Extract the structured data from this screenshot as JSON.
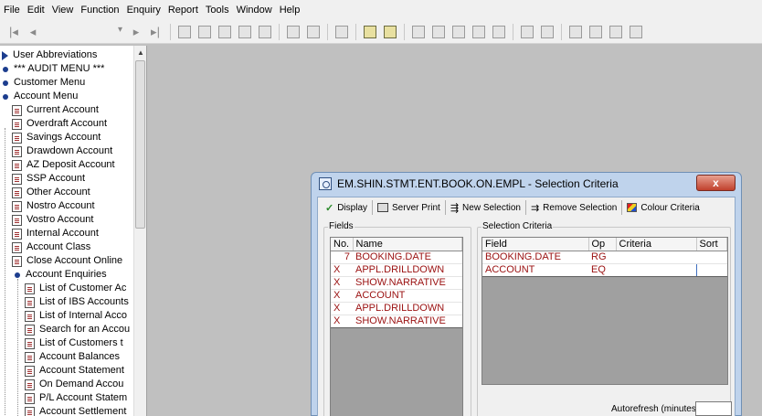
{
  "menubar": {
    "items": [
      {
        "u": "F",
        "rest": "ile"
      },
      {
        "u": "E",
        "rest": "dit"
      },
      {
        "u": "V",
        "rest": "iew"
      },
      {
        "u": "F",
        "rest": "unction",
        "pre": ""
      },
      {
        "u": "",
        "rest": "Enquiry",
        "pre": "",
        "mid_u": "q"
      },
      {
        "u": "R",
        "rest": "eport"
      },
      {
        "u": "T",
        "rest": "ools"
      },
      {
        "u": "W",
        "rest": "indow"
      },
      {
        "u": "H",
        "rest": "elp"
      }
    ],
    "labels": [
      "File",
      "Edit",
      "View",
      "Function",
      "Enquiry",
      "Report",
      "Tools",
      "Window",
      "Help"
    ]
  },
  "tree": {
    "items": [
      {
        "label": "User Abbreviations",
        "icon": "arrow-icon"
      },
      {
        "label": "*** AUDIT MENU ***",
        "icon": "dot-icon"
      },
      {
        "label": "Customer Menu",
        "icon": "dot-icon"
      },
      {
        "label": "Account Menu",
        "icon": "dot-icon"
      },
      {
        "label": "Current Account",
        "icon": "doc-icon"
      },
      {
        "label": "Overdraft Account",
        "icon": "doc-icon"
      },
      {
        "label": "Savings Account",
        "icon": "doc-icon"
      },
      {
        "label": "Drawdown Account",
        "icon": "doc-icon"
      },
      {
        "label": "AZ Deposit Account",
        "icon": "doc-icon"
      },
      {
        "label": "SSP Account",
        "icon": "doc-icon"
      },
      {
        "label": "Other Account",
        "icon": "doc-icon"
      },
      {
        "label": "Nostro Account",
        "icon": "doc-icon"
      },
      {
        "label": "Vostro Account",
        "icon": "doc-icon"
      },
      {
        "label": "Internal Account",
        "icon": "doc-icon"
      },
      {
        "label": "Account Class",
        "icon": "doc-icon"
      },
      {
        "label": "Close Account Online",
        "icon": "doc-icon"
      },
      {
        "label": "Account Enquiries",
        "icon": "dot-icon"
      },
      {
        "label": "List of Customer Ac",
        "icon": "doc-icon"
      },
      {
        "label": "List of IBS Accounts",
        "icon": "doc-icon"
      },
      {
        "label": "List of Internal Acco",
        "icon": "doc-icon"
      },
      {
        "label": "Search for an Accou",
        "icon": "doc-icon"
      },
      {
        "label": "List of Customers t",
        "icon": "doc-icon"
      },
      {
        "label": "Account Balances",
        "icon": "doc-icon"
      },
      {
        "label": "Account Statement",
        "icon": "doc-icon"
      },
      {
        "label": "On Demand Accou",
        "icon": "doc-icon"
      },
      {
        "label": "P/L Account Statem",
        "icon": "doc-icon"
      },
      {
        "label": "Account Settlement",
        "icon": "doc-icon"
      }
    ]
  },
  "dialog": {
    "title": "EM.SHIN.STMT.ENT.BOOK.ON.EMPL - Selection Criteria",
    "close_label": "x",
    "toolbar": {
      "display": "Display",
      "server_print": "Server Print",
      "new_selection": "New Selection",
      "remove_selection": "Remove Selection",
      "colour_criteria": "Colour Criteria"
    },
    "fields": {
      "group_label": "Fields",
      "columns": [
        "No.",
        "Name"
      ],
      "rows": [
        {
          "no": "7",
          "name": "BOOKING.DATE"
        },
        {
          "no": "X",
          "name": "APPL.DRILLDOWN"
        },
        {
          "no": "X",
          "name": "SHOW.NARRATIVE"
        },
        {
          "no": "X",
          "name": "ACCOUNT"
        },
        {
          "no": "X",
          "name": "APPL.DRILLDOWN"
        },
        {
          "no": "X",
          "name": "SHOW.NARRATIVE"
        }
      ]
    },
    "selection": {
      "group_label": "Selection Criteria",
      "columns": [
        "Field",
        "Op",
        "Criteria",
        "Sort"
      ],
      "rows": [
        {
          "field": "BOOKING.DATE",
          "op": "RG",
          "criteria": "",
          "sort": ""
        },
        {
          "field": "ACCOUNT",
          "op": "EQ",
          "criteria": "",
          "sort": ""
        }
      ]
    },
    "autorefresh_label": "Autorefresh (minutes)",
    "autorefresh_value": ""
  }
}
